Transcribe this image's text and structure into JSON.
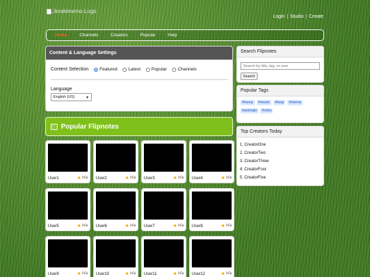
{
  "header": {
    "logo_alt": "Jerakimemo Logo",
    "links": [
      "Login",
      "Studio",
      "Create"
    ]
  },
  "nav": {
    "items": [
      {
        "label": "Home",
        "active": true
      },
      {
        "label": "Channels",
        "active": false
      },
      {
        "label": "Creators",
        "active": false
      },
      {
        "label": "Popular",
        "active": false
      },
      {
        "label": "Help",
        "active": false
      }
    ]
  },
  "settings": {
    "title": "Content & Language Settings",
    "selection_label": "Content Selection",
    "options": [
      {
        "label": "Featured",
        "checked": true
      },
      {
        "label": "Latest",
        "checked": false
      },
      {
        "label": "Popular",
        "checked": false
      },
      {
        "label": "Channels",
        "checked": false
      }
    ],
    "language_label": "Language",
    "language_value": "English (US)"
  },
  "popular": {
    "title": "Popular Flipnotes",
    "icon": "film-icon"
  },
  "flipnotes": [
    {
      "user": "User1",
      "rating": "n/a"
    },
    {
      "user": "User2",
      "rating": "n/a"
    },
    {
      "user": "User3",
      "rating": "n/a"
    },
    {
      "user": "User4",
      "rating": "n/a"
    },
    {
      "user": "User5",
      "rating": "n/a"
    },
    {
      "user": "User6",
      "rating": "n/a"
    },
    {
      "user": "User7",
      "rating": "n/a"
    },
    {
      "user": "User8",
      "rating": "n/a"
    },
    {
      "user": "User9",
      "rating": "n/a"
    },
    {
      "user": "User10",
      "rating": "n/a"
    },
    {
      "user": "User11",
      "rating": "n/a"
    },
    {
      "user": "User12",
      "rating": "n/a"
    }
  ],
  "sidebar": {
    "search": {
      "title": "Search Flipnotes",
      "placeholder": "Search by title, tag, or user",
      "button": "Search"
    },
    "tags": {
      "title": "Popular Tags",
      "items": [
        "#funny",
        "#music",
        "#loop",
        "#meme",
        "#animals",
        "#retro"
      ]
    },
    "creators": {
      "title": "Top Creators Today",
      "items": [
        "CreatorOne",
        "CreatorTwo",
        "CreatorThree",
        "CreatorFour",
        "CreatorFive"
      ]
    }
  },
  "colors": {
    "accent_green": "#7fc11a",
    "nav_active": "#ff5a1a",
    "tag_bg": "#dbe8ff",
    "tag_text": "#1b4fbf",
    "star": "#f0a400"
  }
}
